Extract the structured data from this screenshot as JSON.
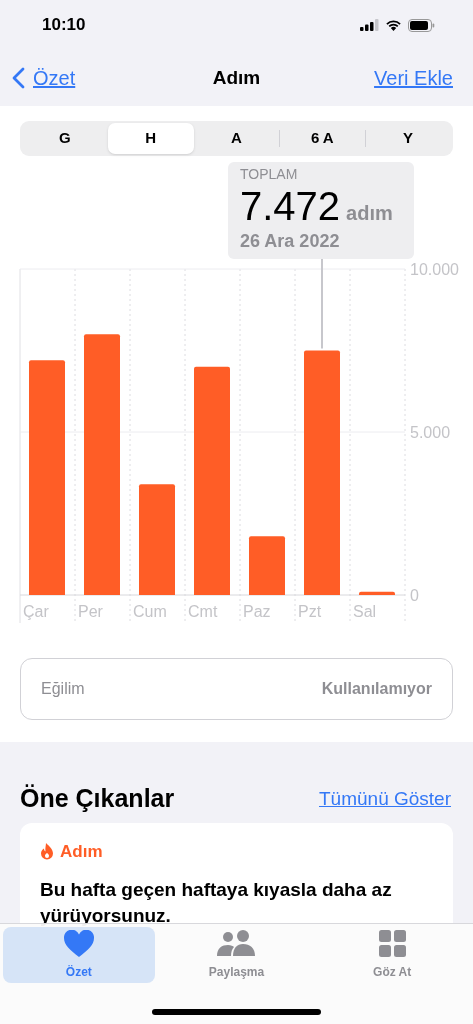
{
  "status_bar": {
    "time": "10:10"
  },
  "nav": {
    "back": "Özet",
    "title": "Adım",
    "action": "Veri Ekle"
  },
  "ranges": [
    {
      "label": "G",
      "selected": false
    },
    {
      "label": "H",
      "selected": true
    },
    {
      "label": "A",
      "selected": false
    },
    {
      "label": "6 A",
      "selected": false
    },
    {
      "label": "Y",
      "selected": false
    }
  ],
  "tooltip": {
    "title": "TOPLAM",
    "value": "7.472",
    "unit": "adım",
    "date": "26 Ara 2022"
  },
  "chart_data": {
    "type": "bar",
    "categories": [
      "Çar",
      "Per",
      "Cum",
      "Cmt",
      "Paz",
      "Pzt",
      "Sal"
    ],
    "series": [
      {
        "color": "#ff5d26",
        "values": [
          7200,
          8000,
          3400,
          7000,
          1800,
          7500,
          100
        ]
      }
    ],
    "annotations": [
      {
        "x": "Pzt"
      }
    ],
    "ylim": [
      0,
      10000
    ],
    "yticks": [
      0,
      {
        "value": 5000,
        "label": "5.000"
      },
      {
        "value": 10000,
        "label": "10.000"
      }
    ]
  },
  "trend": {
    "label": "Eğilim",
    "value": "Kullanılamıyor"
  },
  "highlights": {
    "title": "Öne Çıkanlar",
    "link": "Tümünü Göster",
    "card": {
      "category": "Adım",
      "text": "Bu hafta geçen haftaya kıyasla daha az yürüyorsunuz."
    }
  },
  "tab_bar": [
    {
      "label": "Özet",
      "selected": true
    },
    {
      "label": "Paylaşma",
      "selected": false
    },
    {
      "label": "Göz At",
      "selected": false
    }
  ]
}
